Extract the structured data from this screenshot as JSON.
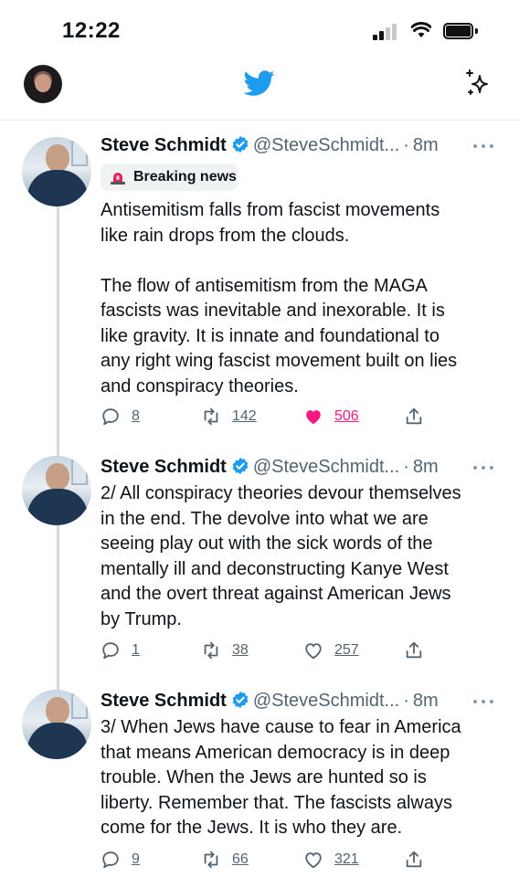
{
  "status_bar": {
    "time": "12:22"
  },
  "colors": {
    "brand": "#1d9bf0",
    "like_active": "#f91880",
    "text": "#0f1419",
    "secondary": "#536471"
  },
  "tweets": [
    {
      "name": "Steve Schmidt",
      "handle": "@SteveSchmidt...",
      "dot": "·",
      "time": "8m",
      "badge": "Breaking news",
      "text": "Antisemitism falls from fascist movements\nlike rain drops from the clouds.\n\nThe flow of antisemitism from the MAGA\nfascists was inevitable and inexorable. It is\nlike gravity. It is innate and foundational to\nany right wing fascist movement built on lies\nand conspiracy theories.",
      "replies": "8",
      "retweets": "142",
      "likes": "506",
      "liked": true
    },
    {
      "name": "Steve Schmidt",
      "handle": "@SteveSchmidt...",
      "dot": "·",
      "time": "8m",
      "text": "2/ All conspiracy theories devour themselves\nin the end. The devolve into what we are\nseeing play out with the sick words of the\nmentally ill and deconstructing Kanye West\nand the overt threat against American Jews\nby Trump.",
      "replies": "1",
      "retweets": "38",
      "likes": "257",
      "liked": false
    },
    {
      "name": "Steve Schmidt",
      "handle": "@SteveSchmidt...",
      "dot": "·",
      "time": "8m",
      "text": "3/ When Jews have cause to fear in America\nthat means American democracy is in deep\ntrouble. When the Jews are hunted so is\nliberty. Remember that. The fascists always\ncome for the Jews. It is who they are.",
      "replies": "9",
      "retweets": "66",
      "likes": "321",
      "liked": false
    }
  ]
}
